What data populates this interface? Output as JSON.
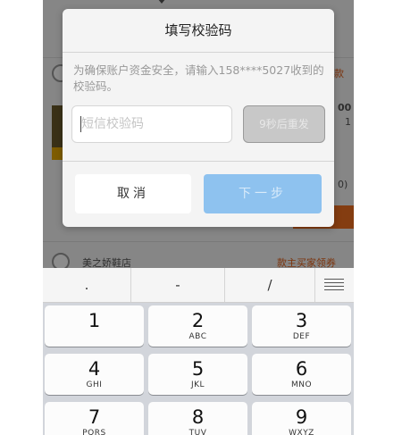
{
  "background_app": {
    "item_top_right_text": "款",
    "price_fragment": "00",
    "qty_fragment": "1",
    "paren_fragment": "0)",
    "store_name": "美之娇鞋店",
    "store_action": "款主买家领券"
  },
  "dialog": {
    "title": "填写校验码",
    "message": "为确保账户资金安全，请输入158****5027收到的校验码。",
    "sms_input": {
      "value": "",
      "placeholder": "短信校验码"
    },
    "resend_label": "9秒后重发",
    "cancel_label": "取消",
    "next_label": "下一步"
  },
  "keyboard": {
    "symbols": [
      ".",
      "-",
      "/"
    ],
    "menu_icon": "list-menu-icon",
    "keys": [
      {
        "digit": "1",
        "letters": ""
      },
      {
        "digit": "2",
        "letters": "ABC"
      },
      {
        "digit": "3",
        "letters": "DEF"
      },
      {
        "digit": "4",
        "letters": "GHI"
      },
      {
        "digit": "5",
        "letters": "JKL"
      },
      {
        "digit": "6",
        "letters": "MNO"
      },
      {
        "digit": "7",
        "letters": "PQRS"
      },
      {
        "digit": "8",
        "letters": "TUV"
      },
      {
        "digit": "9",
        "letters": "WXYZ"
      }
    ]
  },
  "colors": {
    "accent_blue": "#8ec2ef",
    "bg_orange": "#f07020"
  }
}
